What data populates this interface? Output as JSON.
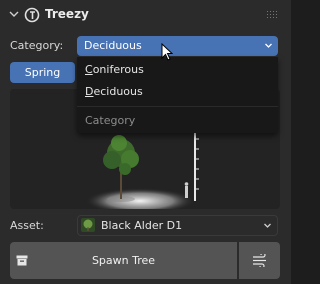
{
  "panel": {
    "title": "Treezy",
    "icons": {
      "collapse": "chevron-down-icon",
      "logo": "treezy-logo-icon",
      "drag": "drag-handle-icon"
    }
  },
  "category": {
    "label": "Category:",
    "selected": "Deciduous",
    "menu": {
      "items": [
        "Coniferous",
        "Deciduous"
      ],
      "heading": "Category"
    }
  },
  "season": {
    "active": "Spring"
  },
  "asset": {
    "label": "Asset:",
    "selected": "Black Alder D1"
  },
  "actions": {
    "spawn_label": "Spawn Tree",
    "spawn_icon": "archive-icon",
    "settings_icon": "wind-settings-icon"
  },
  "colors": {
    "accent": "#4772b3",
    "panel_bg": "#2b2b2b",
    "button_bg": "#545454",
    "menu_bg": "#181818"
  }
}
